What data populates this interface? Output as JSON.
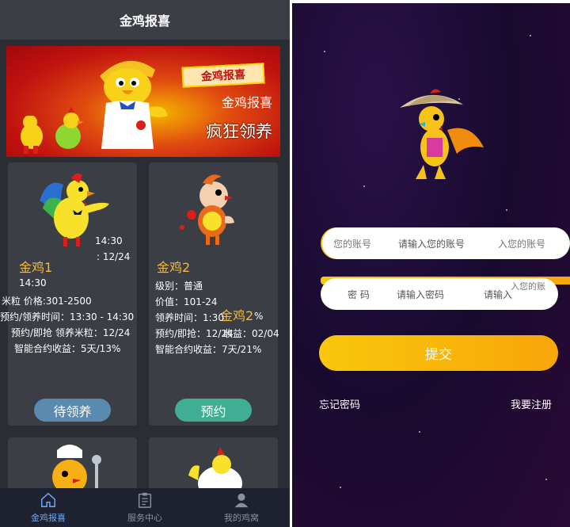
{
  "left": {
    "title": "金鸡报喜",
    "banner": {
      "tag": "金鸡报喜",
      "line1": "金鸡报喜",
      "line2": "疯狂领养"
    },
    "cards": [
      {
        "name": "金鸡1",
        "time_a": "14:30",
        "time_b": ": 12/24",
        "time_c": "14:30",
        "line1": "米粒 价格:301-2500",
        "line2": "预约/领养时间：13:30 - 14:30",
        "line3": "预约/即抢 领养米粒：12/24",
        "line4": "智能合约收益：5天/13%",
        "button": "待领养"
      },
      {
        "name": "金鸡2",
        "overlay": "金鸡2",
        "overlay_pct": "%",
        "line1": "级别：普通",
        "line2": "价值：101-24",
        "line3": "领养时间：1:30",
        "line4": "预约/即抢：12/24",
        "line4b": "收益：02/04",
        "line5": "智能合约收益：7天/21%",
        "button": "预约"
      }
    ],
    "nav": [
      {
        "label": "金鸡报喜",
        "icon": "home-icon",
        "active": true
      },
      {
        "label": "服务中心",
        "icon": "clipboard-icon",
        "active": false
      },
      {
        "label": "我的鸡窝",
        "icon": "user-icon",
        "active": false
      }
    ]
  },
  "right": {
    "account_placeholder": "请输入您的账号",
    "account_ghost_left": "您的账号",
    "account_ghost_right": "入您的账号",
    "password_label": "密 码",
    "password_placeholder": "请输入密码",
    "password_ghost": "入您的账",
    "password_mid1": "密",
    "password_mid2": "密 码",
    "password_tail": "请输入",
    "submit": "提交",
    "forgot": "忘记密码",
    "register": "我要注册"
  },
  "colors": {
    "accent": "#f9b80c",
    "dark_bg": "#2a2d33",
    "name_color": "#f6b93b"
  }
}
